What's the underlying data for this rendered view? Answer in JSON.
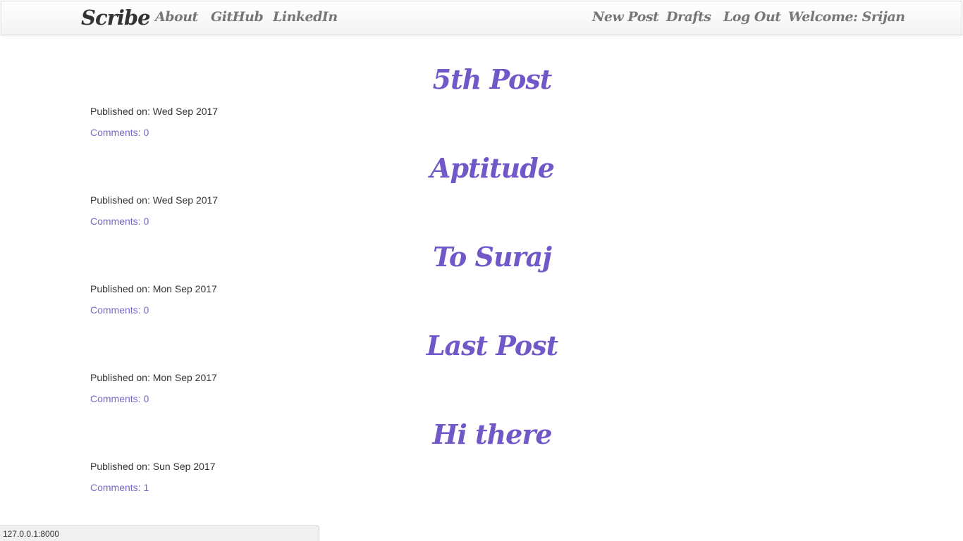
{
  "navbar": {
    "brand": "Scribe",
    "left_links": [
      "About",
      "GitHub",
      "LinkedIn"
    ],
    "right_links": [
      "New Post",
      "Drafts",
      "Log Out"
    ],
    "welcome": "Welcome: Srijan"
  },
  "posts": [
    {
      "title": "5th Post",
      "published": "Published on: Wed Sep 2017",
      "comments": "Comments: 0"
    },
    {
      "title": "Aptitude",
      "published": "Published on: Wed Sep 2017",
      "comments": "Comments: 0"
    },
    {
      "title": "To Suraj",
      "published": "Published on: Mon Sep 2017",
      "comments": "Comments: 0"
    },
    {
      "title": "Last Post",
      "published": "Published on: Mon Sep 2017",
      "comments": "Comments: 0"
    },
    {
      "title": "Hi there",
      "published": "Published on: Sun Sep 2017",
      "comments": "Comments: 1"
    }
  ],
  "status_bar": {
    "url": "127.0.0.1:8000"
  },
  "colors": {
    "title_purple": "#7158c8",
    "link_purple": "#7a66c9",
    "nav_gray": "#777777",
    "brand_dark": "#333333"
  }
}
